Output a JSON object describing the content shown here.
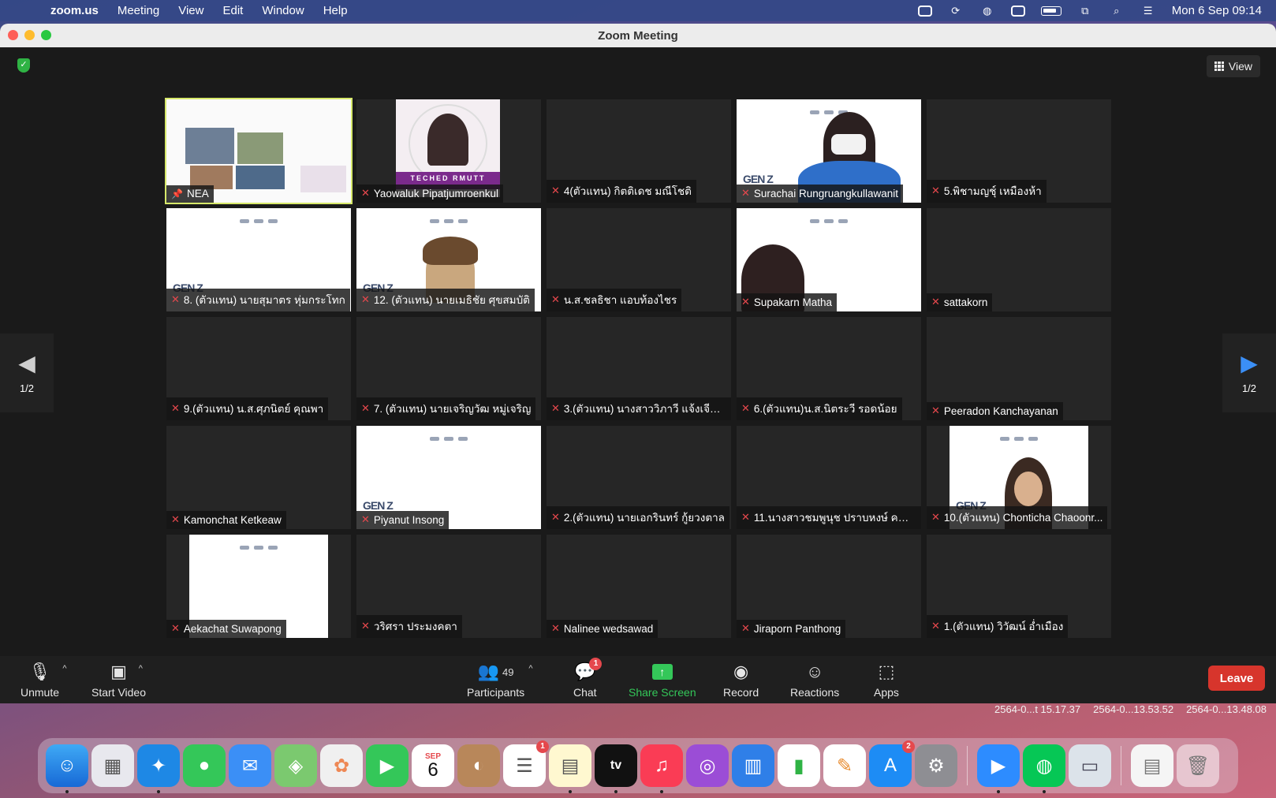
{
  "menubar": {
    "app_name": "zoom.us",
    "menus": [
      "Meeting",
      "View",
      "Edit",
      "Window",
      "Help"
    ],
    "clock": "Mon 6 Sep  09:14"
  },
  "window": {
    "title": "Zoom Meeting"
  },
  "view_button": {
    "label": "View"
  },
  "pager": {
    "left": "1/2",
    "right": "1/2"
  },
  "participants": [
    "NEA",
    "Yaowaluk Pipatjumroenkul",
    "4(ตัวแทน) กิตติเดช มณีโชติ",
    "Surachai Rungruangkullawanit",
    "5.พิชามญชุ์ เหมืองห้า",
    "8. (ตัวแทน) นายสุมาตร หุ่มกระโทก",
    "12. (ตัวแทน) นายเมธิชัย ศุขสมบัติ",
    "น.ส.ชลธิชา แอบท้องไชร",
    "Supakarn Matha",
    "sattakorn",
    "9.(ตัวแทน) น.ส.ศุภนิตย์ คุณพา",
    "7. (ตัวแทน) นายเจริญวัฒ หมู่เจริญ",
    "3.(ตัวแทน) นางสาววิภาวี แจ้งเจียน...",
    "6.(ตัวแทน)น.ส.นิตระวี รอดน้อย",
    "Peeradon Kanchayanan",
    "Kamonchat Ketkeaw",
    "Piyanut Insong",
    "2.(ตัวแทน) นายเอกรินทร์ กู้ยวงตาล",
    "11.นางสาวชมพูนุช ปราบหงษ์ คณะ...",
    "10.(ตัวแทน) Chonticha Chaoonr...",
    "Aekachat Suwapong",
    "วริศรา ประมงคตา",
    "Nalinee wedsawad",
    "Jiraporn Panthong",
    "1.(ตัวแทน) วิวัฒน์ อ่ำเมือง"
  ],
  "tile_text": {
    "teched": "TECHED RMUTT",
    "genz": "GEN Z"
  },
  "toolbar": {
    "unmute": "Unmute",
    "start_video": "Start Video",
    "participants": "Participants",
    "participant_count": "49",
    "chat": "Chat",
    "chat_badge": "1",
    "share_screen": "Share Screen",
    "record": "Record",
    "reactions": "Reactions",
    "apps": "Apps",
    "leave": "Leave"
  },
  "desktop_files": [
    "2564-0...t 15.17.37",
    "2564-0...13.53.52",
    "2564-0...13.48.08"
  ],
  "dock": {
    "calendar_month": "SEP",
    "calendar_day": "6",
    "reminders_badge": "1",
    "appstore_badge": "2",
    "tv_label": "tv"
  },
  "colors": {
    "accent_green": "#34c759",
    "leave_red": "#d7352c",
    "active_speaker": "#d6e86a",
    "mic_off": "#e5484d"
  }
}
